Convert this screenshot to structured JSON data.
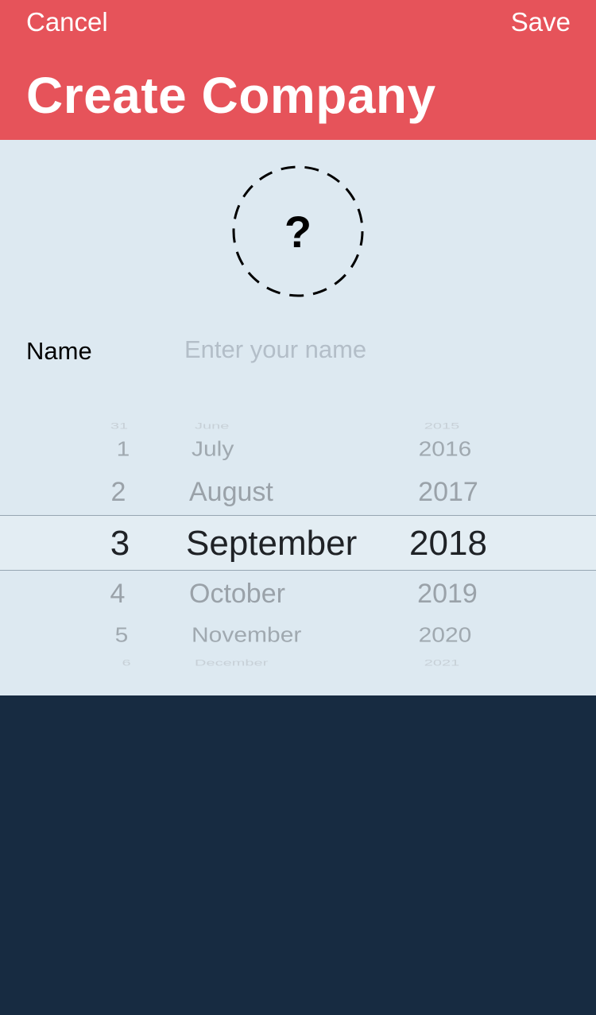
{
  "navbar": {
    "cancel_label": "Cancel",
    "save_label": "Save",
    "title": "Create Company"
  },
  "photo": {
    "placeholder_glyph": "?"
  },
  "form": {
    "name_label": "Name",
    "name_placeholder": "Enter your name",
    "name_value": ""
  },
  "date_picker": {
    "days": [
      "31",
      "1",
      "2",
      "3",
      "4",
      "5",
      "6"
    ],
    "months": [
      "June",
      "July",
      "August",
      "September",
      "October",
      "November",
      "December"
    ],
    "years": [
      "2015",
      "2016",
      "2017",
      "2018",
      "2019",
      "2020",
      "2021"
    ],
    "selected": {
      "day": "3",
      "month": "September",
      "year": "2018"
    }
  },
  "colors": {
    "header": "#e6535a",
    "panel": "#dde9f1",
    "background": "#172b41"
  }
}
